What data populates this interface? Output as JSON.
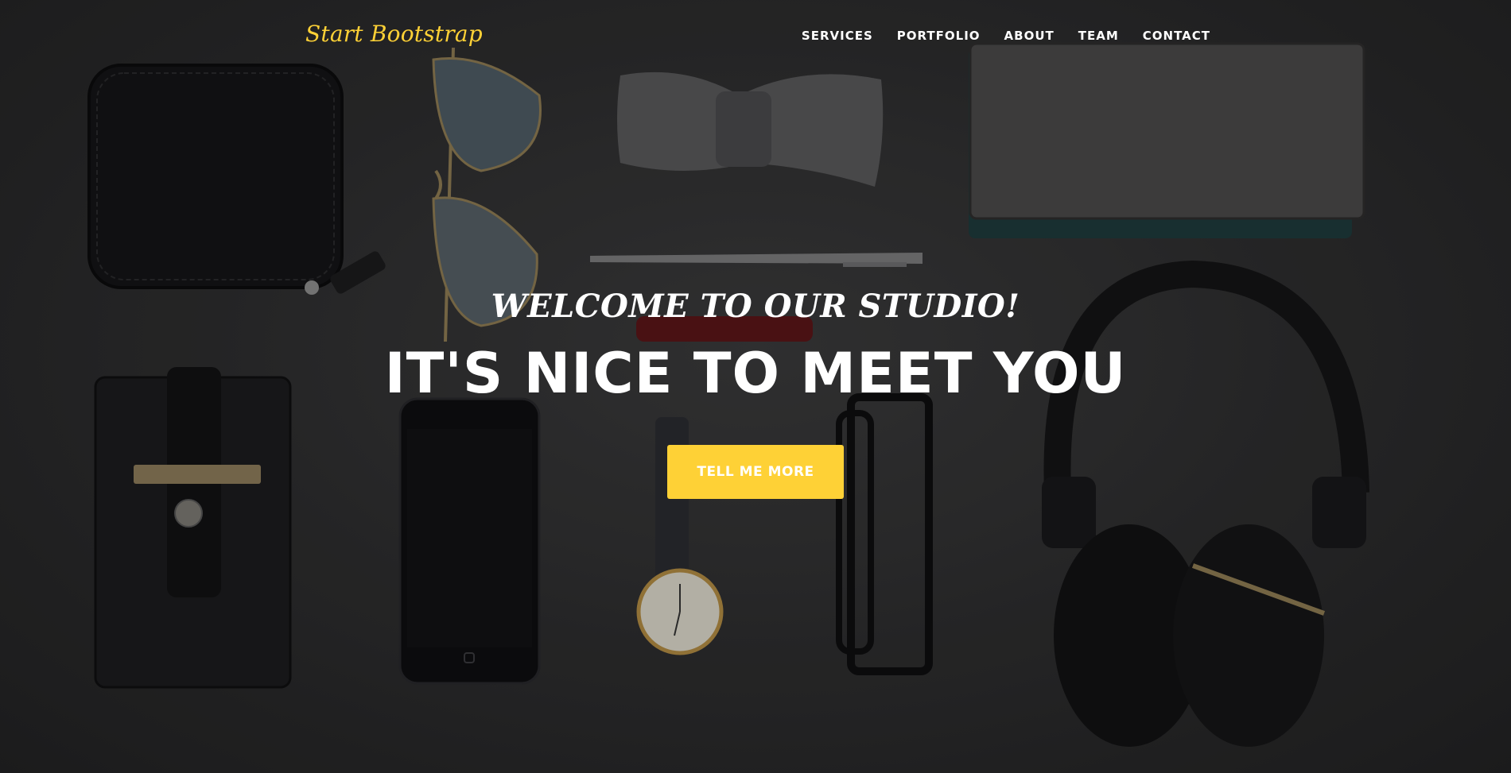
{
  "navbar": {
    "brand": "Start Bootstrap",
    "links": [
      "SERVICES",
      "PORTFOLIO",
      "ABOUT",
      "TEAM",
      "CONTACT"
    ]
  },
  "intro": {
    "lead_in": "WELCOME TO OUR STUDIO!",
    "heading": "IT'S NICE TO MEET YOU",
    "button": "TELL ME MORE"
  },
  "colors": {
    "accent": "#fed136",
    "background": "#2b2b2c",
    "text": "#ffffff"
  },
  "icons": [
    "wallet-icon",
    "sunglasses-icon",
    "bow-tie-icon",
    "notebook-icon",
    "pen-icon",
    "lipstick-icon",
    "phone-case-icon",
    "smartphone-icon",
    "wristwatch-icon",
    "eyeglasses-icon",
    "headphones-icon"
  ]
}
